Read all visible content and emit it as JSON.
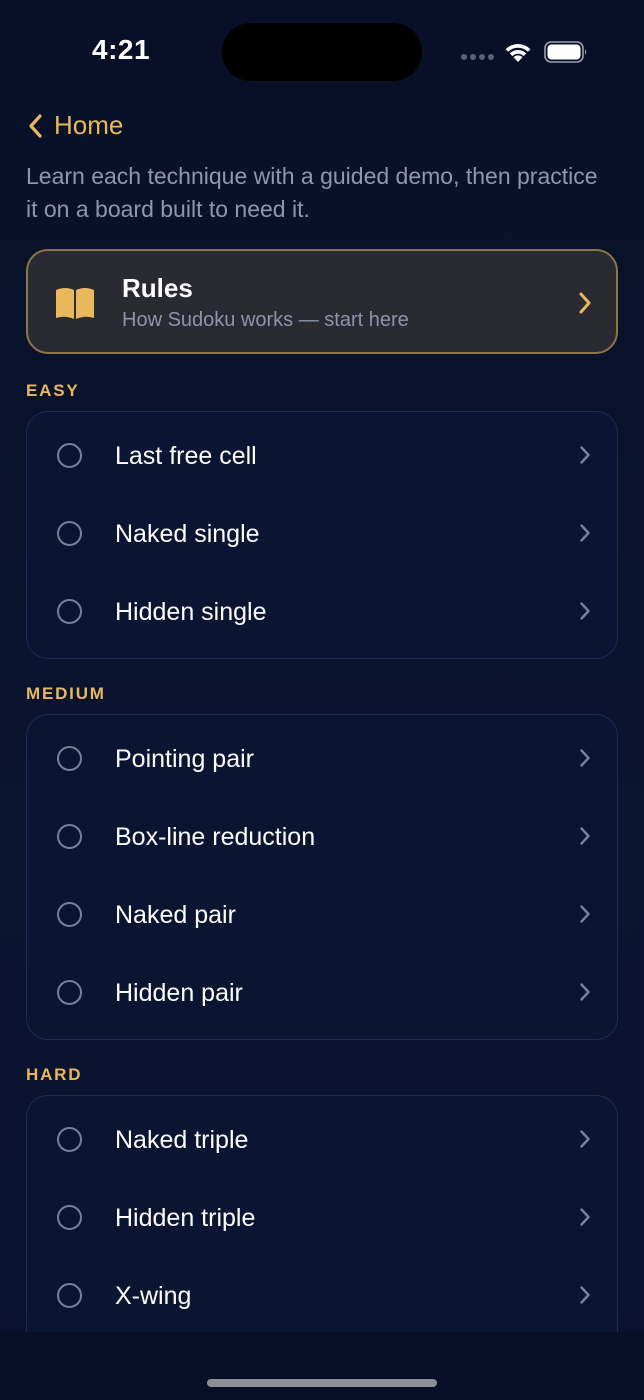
{
  "status_bar": {
    "time": "4:21"
  },
  "nav": {
    "back_label": "Home"
  },
  "intro": "Learn each technique with a guided demo, then practice it on a board built to need it.",
  "rules_card": {
    "title": "Rules",
    "subtitle": "How Sudoku works — start here",
    "icon": "book-icon"
  },
  "sections": [
    {
      "title": "EASY",
      "items": [
        {
          "label": "Last free cell"
        },
        {
          "label": "Naked single"
        },
        {
          "label": "Hidden single"
        }
      ]
    },
    {
      "title": "MEDIUM",
      "items": [
        {
          "label": "Pointing pair"
        },
        {
          "label": "Box-line reduction"
        },
        {
          "label": "Naked pair"
        },
        {
          "label": "Hidden pair"
        }
      ]
    },
    {
      "title": "HARD",
      "items": [
        {
          "label": "Naked triple"
        },
        {
          "label": "Hidden triple"
        },
        {
          "label": "X-wing"
        }
      ]
    }
  ],
  "colors": {
    "accent": "#e9b75c",
    "background": "#081028",
    "card": "#0a1433",
    "card_border": "#1f2c52",
    "rules_card": "#2a2a32",
    "rules_border": "#8e7549",
    "muted_text": "#8e97b0"
  }
}
